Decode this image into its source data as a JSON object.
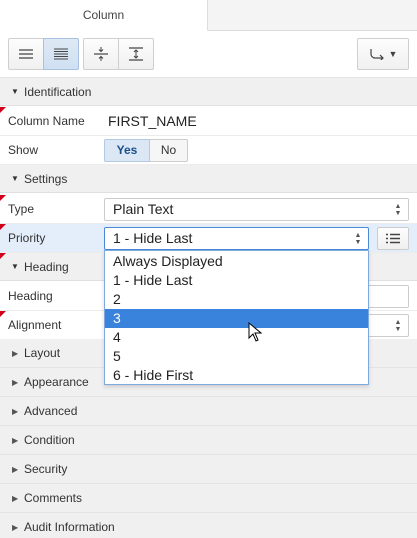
{
  "tabs": [
    {
      "label": "Column"
    }
  ],
  "toolbar": {
    "buttons": [
      {
        "name": "show-common-button",
        "icon": "lines-icon"
      },
      {
        "name": "show-all-button",
        "icon": "lines-dense-icon"
      },
      {
        "name": "collapse-all-button",
        "icon": "collapse-icon"
      },
      {
        "name": "expand-all-button",
        "icon": "expand-icon"
      }
    ],
    "go_to_group_icon": "arrow-hook-icon"
  },
  "groups": {
    "identification": {
      "label": "Identification",
      "column_name": {
        "label": "Column Name",
        "value": "FIRST_NAME"
      },
      "show": {
        "label": "Show",
        "yes": "Yes",
        "no": "No",
        "selected": "Yes"
      }
    },
    "settings": {
      "label": "Settings",
      "type": {
        "label": "Type",
        "value": "Plain Text"
      },
      "priority": {
        "label": "Priority",
        "value": "1 - Hide Last"
      }
    },
    "heading": {
      "label": "Heading",
      "heading": {
        "label": "Heading"
      },
      "alignment": {
        "label": "Alignment"
      }
    }
  },
  "priority_options": [
    "Always Displayed",
    "1 - Hide Last",
    "2",
    "3",
    "4",
    "5",
    "6 - Hide First"
  ],
  "priority_highlighted": "3",
  "collapsed_groups": [
    "Layout",
    "Appearance",
    "Advanced",
    "Condition",
    "Security",
    "Comments",
    "Audit Information"
  ],
  "colors": {
    "accent": "#3a83dc",
    "required_flag": "#d0021b",
    "selected_row": "#e4eefa"
  }
}
